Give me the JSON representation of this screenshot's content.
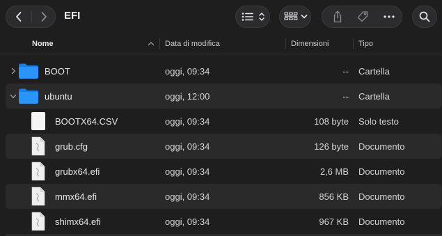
{
  "window": {
    "title": "EFI"
  },
  "toolbar": {
    "back_icon": "chevron-left-icon",
    "forward_icon": "chevron-right-icon",
    "view_icon": "list-view-icon",
    "group_icon": "grid-group-icon",
    "share_icon": "share-icon",
    "tag_icon": "tag-icon",
    "more_icon": "ellipsis-icon",
    "search_icon": "search-icon"
  },
  "columns": {
    "name": "Nome",
    "date": "Data di modifica",
    "size": "Dimensioni",
    "kind": "Tipo"
  },
  "rows": [
    {
      "name": "BOOT",
      "date": "oggi, 09:34",
      "size": "--",
      "kind": "Cartella",
      "icon": "folder-icon",
      "expanded": false
    },
    {
      "name": "ubuntu",
      "date": "oggi, 12:00",
      "size": "--",
      "kind": "Cartella",
      "icon": "folder-icon",
      "expanded": true
    },
    {
      "name": "BOOTX64.CSV",
      "date": "oggi, 09:34",
      "size": "108 byte",
      "kind": "Solo testo",
      "icon": "text-file-icon"
    },
    {
      "name": "grub.cfg",
      "date": "oggi, 09:34",
      "size": "126 byte",
      "kind": "Documento",
      "icon": "document-icon"
    },
    {
      "name": "grubx64.efi",
      "date": "oggi, 09:34",
      "size": "2,6 MB",
      "kind": "Documento",
      "icon": "document-icon"
    },
    {
      "name": "mmx64.efi",
      "date": "oggi, 09:34",
      "size": "856 KB",
      "kind": "Documento",
      "icon": "document-icon"
    },
    {
      "name": "shimx64.efi",
      "date": "oggi, 09:34",
      "size": "967 KB",
      "kind": "Documento",
      "icon": "document-icon"
    }
  ],
  "colors": {
    "folder": "#1f8ff5",
    "background": "#1e1e1e",
    "row_alt": "#2a2a2a"
  }
}
